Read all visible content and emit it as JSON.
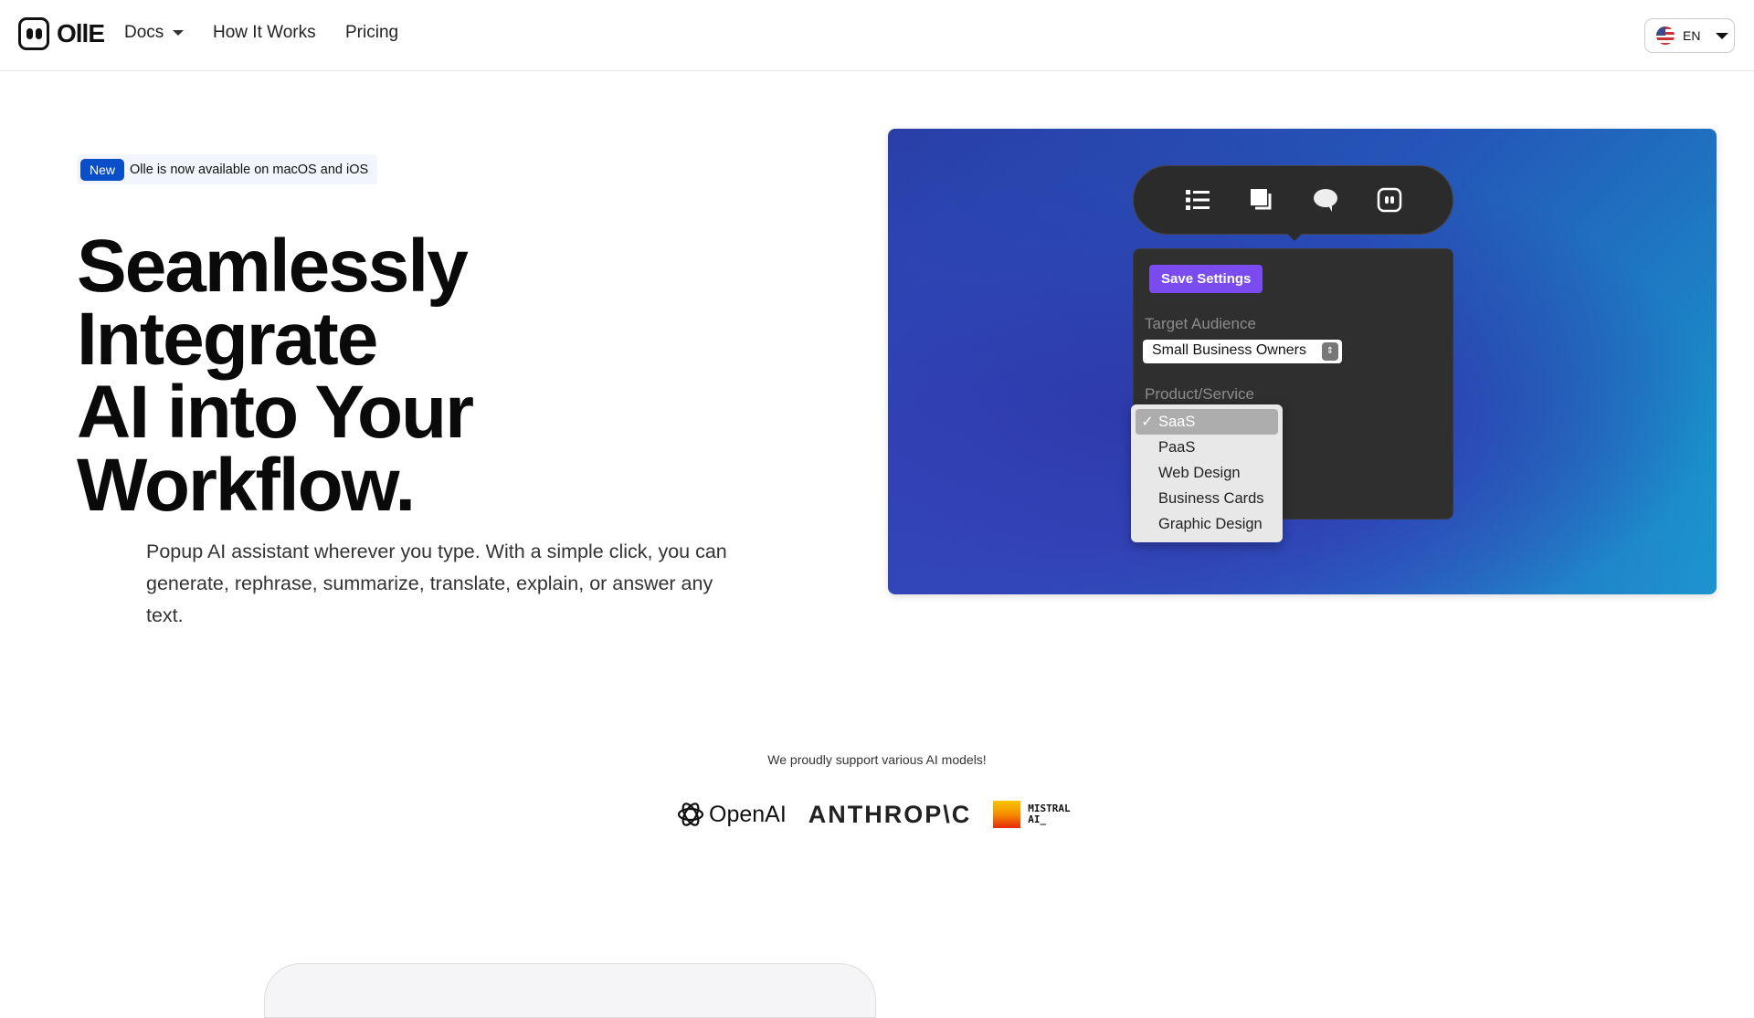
{
  "header": {
    "brand": "OllE",
    "nav": [
      {
        "label": "Docs",
        "has_dropdown": true
      },
      {
        "label": "How It Works"
      },
      {
        "label": "Pricing"
      }
    ],
    "language": {
      "code": "EN",
      "flag": "us-flag"
    }
  },
  "announcement": {
    "badge": "New",
    "text": "Olle is now available on macOS and iOS",
    "badge_color": "#0b4fc8"
  },
  "hero": {
    "title_lines": [
      "Seamlessly",
      "Integrate",
      "AI into Your",
      "Workflow."
    ],
    "description": "Popup AI assistant wherever you type. With a simple click, you can generate, rephrase, summarize, translate, explain, or answer any text."
  },
  "demo": {
    "toolbar_icons": [
      "list-icon",
      "copy-icon",
      "chat-bubble-icon",
      "olle-logo-icon"
    ],
    "save_button": "Save Settings",
    "save_color": "#7a4cf0",
    "target_audience_label": "Target Audience",
    "target_audience_value": "Small Business Owners",
    "product_label": "Product/Service",
    "product_options": [
      "SaaS",
      "PaaS",
      "Web Design",
      "Business Cards",
      "Graphic Design"
    ],
    "product_selected": "SaaS",
    "check": "✓"
  },
  "models": {
    "heading": "We proudly support various AI models!",
    "openai": "OpenAI",
    "anthropic": "ANTHROP\\C",
    "mistral_line1": "MISTRAL",
    "mistral_line2": "AI_"
  }
}
